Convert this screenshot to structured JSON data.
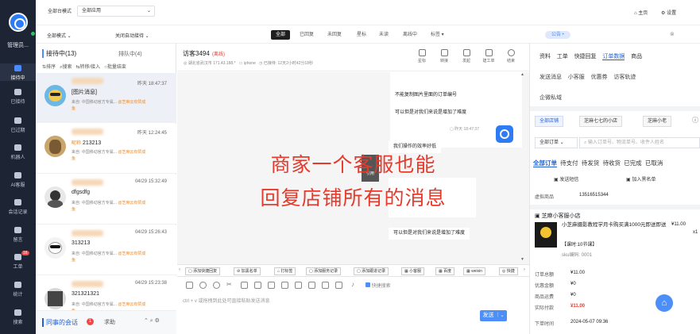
{
  "sidebar": {
    "title": "管理员...",
    "items": [
      {
        "label": "接待中",
        "icon": "chat-icon",
        "active": true
      },
      {
        "label": "已接待",
        "icon": "check-chat-icon"
      },
      {
        "label": "已过期",
        "icon": "clock-icon"
      },
      {
        "label": "机器人",
        "icon": "robot-icon"
      },
      {
        "label": "AI客服",
        "icon": "ai-icon"
      },
      {
        "label": "会话记录",
        "icon": "history-icon"
      },
      {
        "label": "留言",
        "icon": "note-icon"
      },
      {
        "label": "工单",
        "icon": "ticket-icon",
        "badge": "16"
      },
      {
        "label": "统计",
        "icon": "stats-icon"
      },
      {
        "label": "搜索",
        "icon": "search-icon"
      }
    ]
  },
  "topbar": {
    "mode_label": "全部台模式",
    "mode_value": "全部应用",
    "sel2": "全部模式",
    "sel3": "关闭自动接待",
    "home": "主页",
    "settings": "设置"
  },
  "filters": [
    "全部",
    "已回复",
    "未回复",
    "星标",
    "未读",
    "离线中",
    "标签"
  ],
  "list": {
    "tab_active": "接待中(13)",
    "tab_other": "排队中(4)",
    "actions": [
      "排序",
      "搜索",
      "转移/接入",
      "批量结束"
    ],
    "items": [
      {
        "time": "昨天 18:47:37",
        "msg": "[图片消息]",
        "src": "来自: 中国移动官方专属...",
        "tag": "@芝麻云有赞成",
        "tail": "鱼"
      },
      {
        "time": "昨天 12:24:45",
        "msg": "213213",
        "src": "来自: 中国移动官方专属...",
        "tag": "@芝麻云有赞成",
        "tail": "鱼",
        "prefix": "昵称"
      },
      {
        "time": "04/29 15:32:49",
        "msg": "dfgsdfg",
        "src": "来自: 中国移动官方专属...",
        "tag": "@芝麻云有赞成",
        "tail": "鱼"
      },
      {
        "time": "04/29 15:26:43",
        "msg": "313213",
        "src": "来自: 中国移动官方专属...",
        "tag": "@芝麻云有赞成",
        "tail": "鱼"
      },
      {
        "time": "04/29 15:23:38",
        "msg": "321321321",
        "src": "来自: 中国移动官方专属...",
        "tag": "@芝麻云有赞成",
        "tail": "鱼"
      }
    ],
    "footer": "同事的会话",
    "footer_badge": "1",
    "footer_help": "求助"
  },
  "chat": {
    "visitor": "访客3494",
    "status": "(离线)",
    "location": "湖北省武汉市 171.43.188.*",
    "device": "iphone",
    "duration": "已接待: 12天2小时42分18秒",
    "head_icons": [
      "星标",
      "转接",
      "发起",
      "建工单",
      "结束"
    ],
    "bubbles": [
      "不能复制图片里面的订单编号",
      "可以但是对我们来说是增加了难度",
      "我们操作的效率好低",
      "可以但是对我们来说是增加了难度"
    ],
    "bubble_time": "昨天 18:47:37",
    "quote": "引用",
    "overlay1": "商家一个客服也能",
    "overlay2": "回复店铺所有的消息",
    "tools": [
      "添加快捷回复",
      "加黑名单",
      "打标签",
      "添加服务记录",
      "添加跟进记录",
      "小客服",
      "百度",
      "weixin",
      "快捷"
    ],
    "quick_search": "快捷搜索",
    "hint": "ctrl + v 或拖拽到此处可直接粘贴发送消息",
    "send": "发送"
  },
  "right": {
    "public": "公告",
    "tabs1": [
      "资料",
      "工单",
      "快捷回复",
      "订单数据",
      "商品"
    ],
    "tabs2": [
      "发送消息",
      "小客服",
      "优惠券",
      "访客轨迹"
    ],
    "enterprise": "企微私域",
    "shops": [
      "全部店铺",
      "芝麻七七的小店",
      "芝麻小老"
    ],
    "order_sel": "全部订单",
    "order_search": "输入订单号、物流单号、收件人姓名",
    "order_tabs": [
      "全部订单",
      "待支付",
      "待发货",
      "待收货",
      "已完成",
      "已取消"
    ],
    "send_sms": "发送短信",
    "add_blacklist": "加入黑名单",
    "virtual_label": "虚拟商品",
    "virtual_value": "13516515344",
    "shop_name": "芝麻小客服小店",
    "product": "小芝麻摄影教程学月卡购买满1000元即送即送",
    "price": "¥11.00",
    "qty": "x1",
    "course": "【课时:10节课】",
    "sku": "sku编码: 0001",
    "summary": [
      [
        "订单总额",
        "¥11.00"
      ],
      [
        "优惠金额",
        "¥0"
      ],
      [
        "商品运费",
        "¥0"
      ],
      [
        "实际付款",
        "¥11.00"
      ],
      [
        "下单时间",
        "2024-05-07 09:36"
      ]
    ]
  },
  "colors": {
    "accent": "#4d8ff8",
    "overlay": "#e53a2c",
    "sidebar": "#1d2433"
  }
}
